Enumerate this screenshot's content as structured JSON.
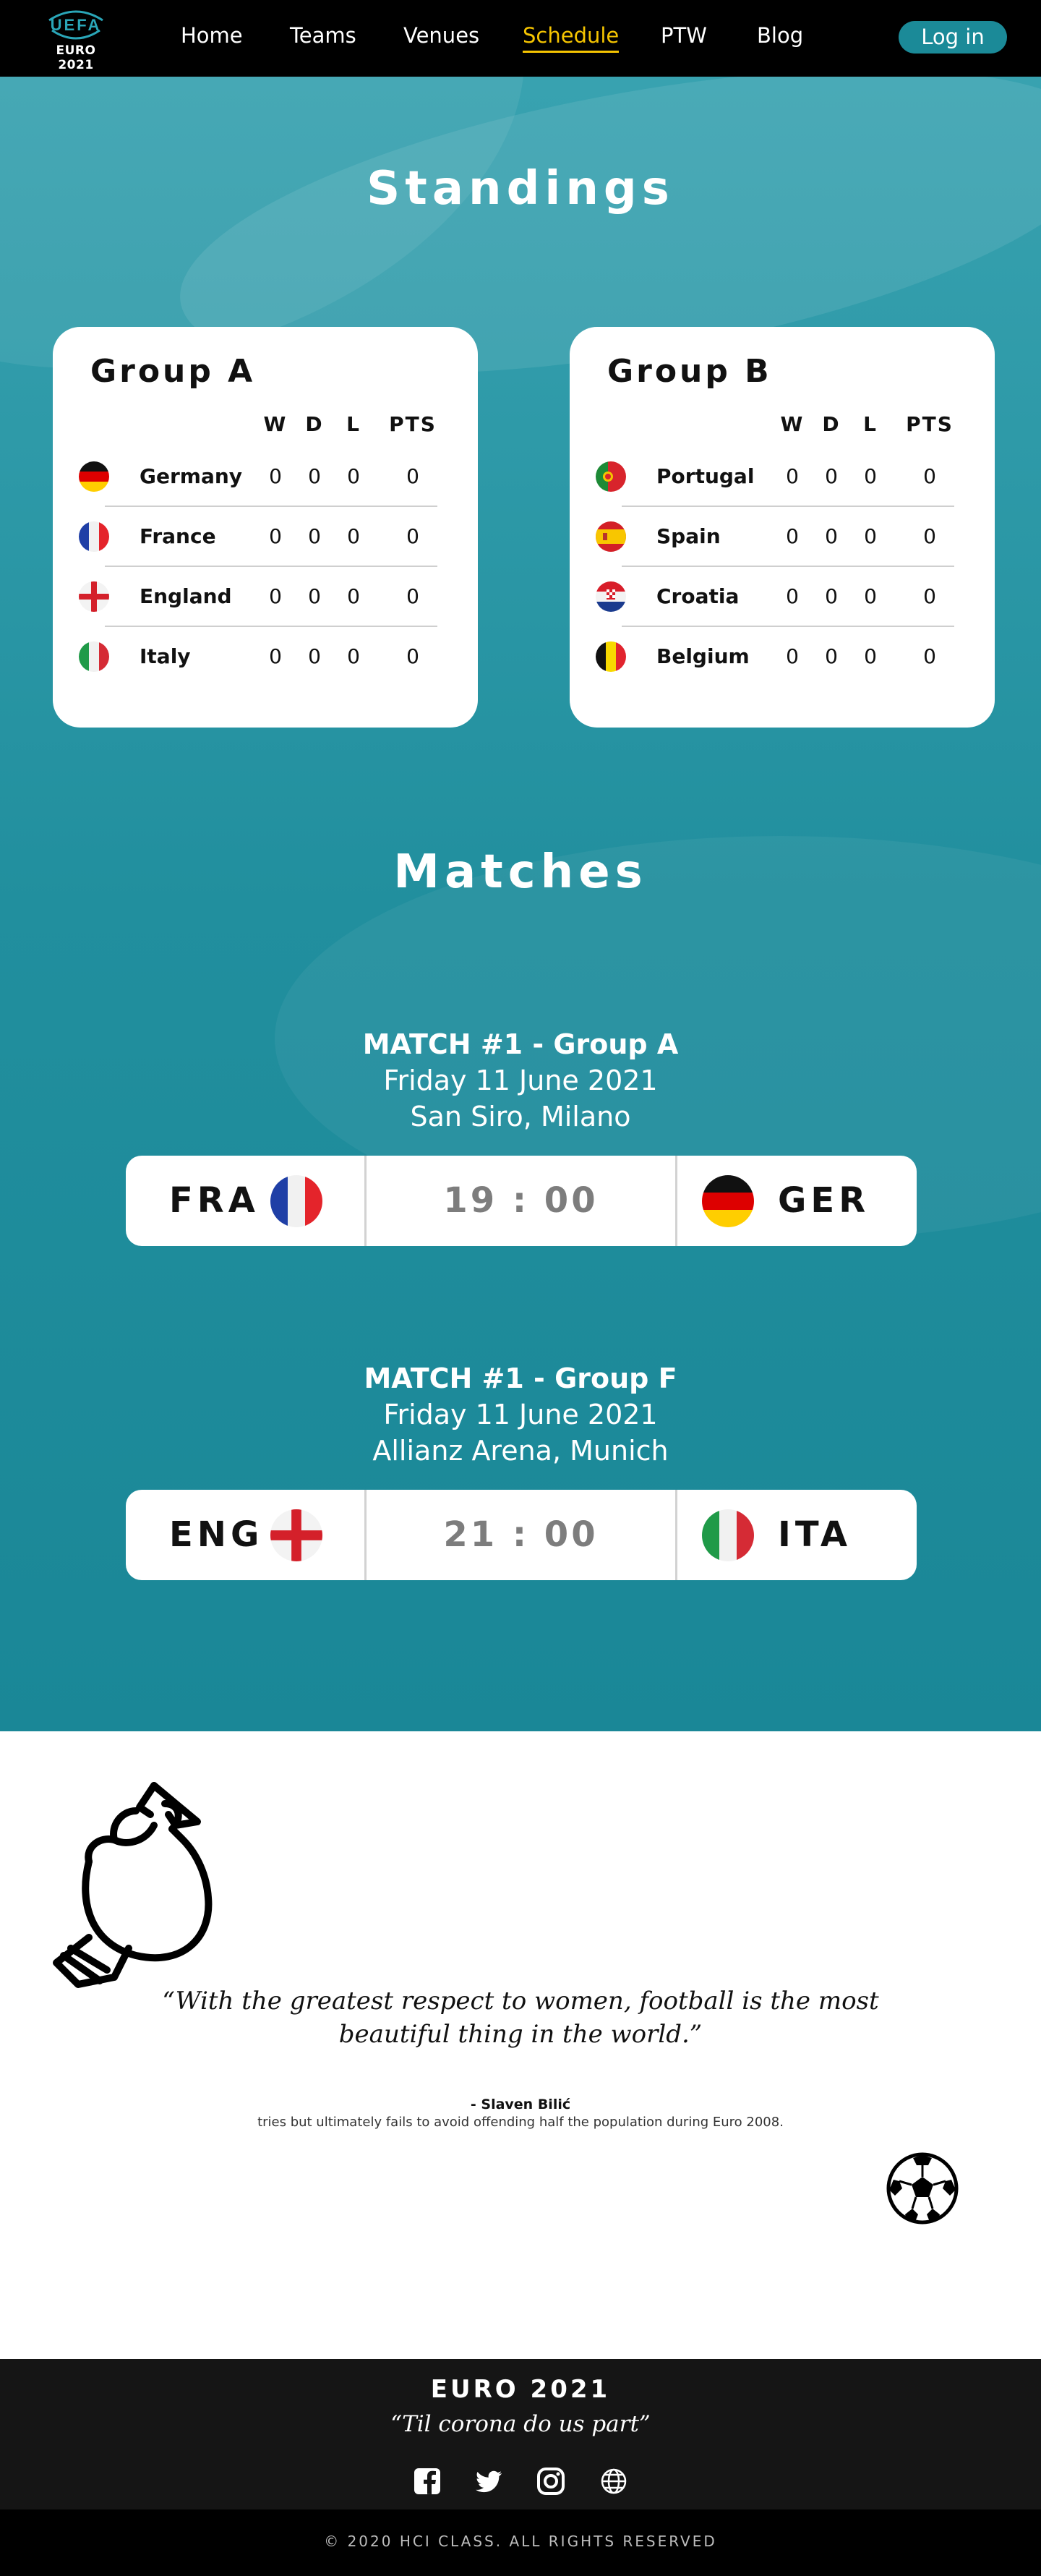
{
  "nav": {
    "logo_top": "UEFA",
    "logo_bottom": "EURO 2021",
    "links": [
      "Home",
      "Teams",
      "Venues",
      "Schedule",
      "PTW",
      "Blog"
    ],
    "active": "Schedule",
    "login": "Log in"
  },
  "standings": {
    "title": "Standings",
    "columns": [
      "W",
      "D",
      "L",
      "PTS"
    ],
    "groups": [
      {
        "name": "Group A",
        "teams": [
          {
            "name": "Germany",
            "flag": "germany-flag",
            "w": "0",
            "d": "0",
            "l": "0",
            "pts": "0"
          },
          {
            "name": "France",
            "flag": "france-flag",
            "w": "0",
            "d": "0",
            "l": "0",
            "pts": "0"
          },
          {
            "name": "England",
            "flag": "england-flag",
            "w": "0",
            "d": "0",
            "l": "0",
            "pts": "0"
          },
          {
            "name": "Italy",
            "flag": "italy-flag",
            "w": "0",
            "d": "0",
            "l": "0",
            "pts": "0"
          }
        ]
      },
      {
        "name": "Group B",
        "teams": [
          {
            "name": "Portugal",
            "flag": "portugal-flag",
            "w": "0",
            "d": "0",
            "l": "0",
            "pts": "0"
          },
          {
            "name": "Spain",
            "flag": "spain-flag",
            "w": "0",
            "d": "0",
            "l": "0",
            "pts": "0"
          },
          {
            "name": "Croatia",
            "flag": "croatia-flag",
            "w": "0",
            "d": "0",
            "l": "0",
            "pts": "0"
          },
          {
            "name": "Belgium",
            "flag": "belgium-flag",
            "w": "0",
            "d": "0",
            "l": "0",
            "pts": "0"
          }
        ]
      }
    ]
  },
  "matches": {
    "title": "Matches",
    "items": [
      {
        "heading": "MATCH #1 - Group A",
        "date": "Friday 11 June 2021",
        "venue": "San Siro, Milano",
        "home": "FRA",
        "home_flag": "france-flag",
        "time": "19 : 00",
        "away": "GER",
        "away_flag": "germany-flag"
      },
      {
        "heading": "MATCH #1 - Group F",
        "date": "Friday 11 June 2021",
        "venue": "Allianz Arena, Munich",
        "home": "ENG",
        "home_flag": "england-flag",
        "time": "21 : 00",
        "away": "ITA",
        "away_flag": "italy-flag"
      }
    ]
  },
  "quote": {
    "text": "“With the greatest respect to women, football is the most beautiful thing in the world.”",
    "author": "- Slaven Bilić",
    "note": "tries but ultimately fails to avoid offending half the population during Euro 2008."
  },
  "footer": {
    "title": "EURO 2021",
    "tagline": "“Til corona do us part”",
    "social_icons": [
      "facebook-icon",
      "twitter-icon",
      "instagram-icon",
      "globe-icon"
    ],
    "copyright": "© 2020 HCI CLASS. ALL RIGHTS RESERVED"
  },
  "colors": {
    "nav_bg": "#000000",
    "accent_active": "#f5c400",
    "teal": "#218f9e",
    "login_bg": "#1b8a98",
    "footer_bg": "#151515"
  }
}
